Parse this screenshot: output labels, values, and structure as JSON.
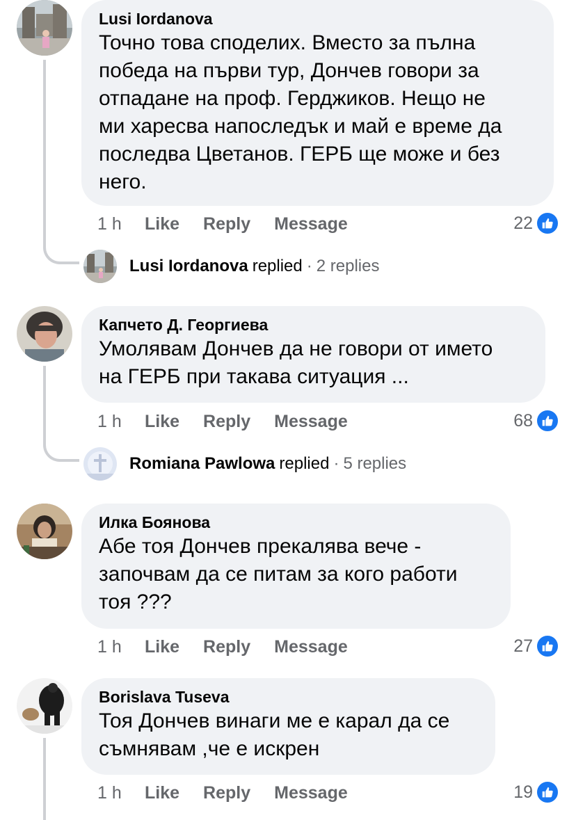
{
  "comments": [
    {
      "author": "Lusi Iordanova",
      "text": "Точно това споделих. Вместо за пълна\nпобеда на първи тур, Дончев говори за\nотпадане на проф. Герджиков. Нещо не\nми харесва напоследък и май е време да\nпоследва Цветанов. ГЕРБ ще може и без\nнего.",
      "time": "1 h",
      "like_label": "Like",
      "reply_label": "Reply",
      "message_label": "Message",
      "likes": "22",
      "reply_summary": {
        "name": "Lusi Iordanova",
        "verb": "replied",
        "dot": "·",
        "count": "2 replies"
      }
    },
    {
      "author": "Капчето Д. Георгиева",
      "text": "Умолявам Дончев да не говори от името\nна ГЕРБ при такава ситуация ...",
      "time": "1 h",
      "like_label": "Like",
      "reply_label": "Reply",
      "message_label": "Message",
      "likes": "68",
      "reply_summary": {
        "name": "Romiana Pawlowa",
        "verb": "replied",
        "dot": "·",
        "count": "5 replies"
      }
    },
    {
      "author": "Илка Боянова",
      "text": "Абе тоя Дончев прекалява вече -\nзапочвам да се питам за кого работи\nтоя ???",
      "time": "1 h",
      "like_label": "Like",
      "reply_label": "Reply",
      "message_label": "Message",
      "likes": "27"
    },
    {
      "author": "Borislava Tuseva",
      "text": "Тоя Дончев винаги ме е карал да се\nсъмнявам ,че е искрен",
      "time": "1 h",
      "like_label": "Like",
      "reply_label": "Reply",
      "message_label": "Message",
      "likes": "19"
    }
  ],
  "colors": {
    "bubble": "#f0f2f5",
    "secondary_text": "#65676b",
    "like_blue": "#1877f2",
    "thread_line": "#ced0d4"
  },
  "icons": {
    "like_badge": "thumbs-up-icon"
  }
}
